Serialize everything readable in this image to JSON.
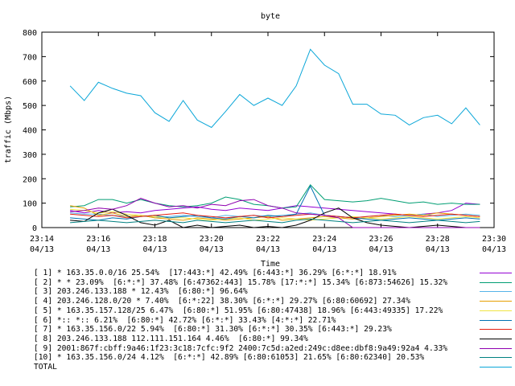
{
  "chart_data": {
    "type": "line",
    "title": "byte",
    "xlabel": "Time",
    "ylabel": "traffic (Mbps)",
    "ylim": [
      0,
      800
    ],
    "yticks": [
      0,
      100,
      200,
      300,
      400,
      500,
      600,
      700,
      800
    ],
    "xlim": [
      "23:14",
      "23:30"
    ],
    "xticks": [
      {
        "time": "23:14",
        "date": "04/13"
      },
      {
        "time": "23:16",
        "date": "04/13"
      },
      {
        "time": "23:18",
        "date": "04/13"
      },
      {
        "time": "23:20",
        "date": "04/13"
      },
      {
        "time": "23:22",
        "date": "04/13"
      },
      {
        "time": "23:24",
        "date": "04/13"
      },
      {
        "time": "23:26",
        "date": "04/13"
      },
      {
        "time": "23:28",
        "date": "04/13"
      },
      {
        "time": "23:30",
        "date": "04/13"
      }
    ],
    "grid": false,
    "legend_position": "bottom",
    "x": [
      "23:15",
      "23:15:30",
      "23:16",
      "23:16:30",
      "23:17",
      "23:17:30",
      "23:18",
      "23:18:30",
      "23:19",
      "23:19:30",
      "23:20",
      "23:20:30",
      "23:21",
      "23:21:30",
      "23:22",
      "23:22:30",
      "23:23",
      "23:23:30",
      "23:24",
      "23:24:30",
      "23:25",
      "23:25:30",
      "23:26",
      "23:26:30",
      "23:27",
      "23:27:30",
      "23:28",
      "23:28:30",
      "23:29",
      "23:29:30"
    ],
    "series": [
      {
        "name": "[ 1] * 163.35.0.0/16 25.54%  [17:443:*] 42.49% [6:443:*] 36.29% [6:*:*] 18.91%",
        "color": "#9400d3",
        "values": [
          70,
          60,
          70,
          60,
          65,
          60,
          70,
          75,
          80,
          85,
          75,
          70,
          80,
          75,
          70,
          80,
          90,
          85,
          80,
          75,
          70,
          65,
          60,
          55,
          50,
          55,
          60,
          70,
          100,
          95
        ]
      },
      {
        "name": "[ 2] * * 23.09%  [6:*:*] 37.48% [6:47362:443] 15.78% [17:*:*] 15.34% [6:873:54626] 15.32%",
        "color": "#009e73",
        "values": [
          85,
          90,
          115,
          115,
          100,
          115,
          100,
          90,
          85,
          90,
          100,
          125,
          115,
          95,
          90,
          80,
          85,
          175,
          115,
          110,
          105,
          110,
          120,
          110,
          100,
          105,
          95,
          100,
          95,
          95
        ]
      },
      {
        "name": "[ 3] 203.246.133.188 * 12.43%  [6:80:*] 96.64%",
        "color": "#56b4e9",
        "values": [
          60,
          55,
          55,
          50,
          45,
          50,
          40,
          45,
          50,
          45,
          40,
          50,
          45,
          50,
          45,
          50,
          55,
          60,
          50,
          45,
          40,
          45,
          50,
          45,
          50,
          55,
          45,
          50,
          55,
          50
        ]
      },
      {
        "name": "[ 4] 203.246.128.0/20 * 7.40%  [6:*:22] 38.30% [6:*:*] 29.27% [6:80:60692] 27.34%",
        "color": "#e69f00",
        "values": [
          90,
          80,
          50,
          60,
          45,
          50,
          40,
          35,
          30,
          40,
          35,
          30,
          35,
          40,
          45,
          30,
          35,
          40,
          45,
          40,
          35,
          40,
          45,
          50,
          55,
          50,
          60,
          55,
          50,
          45
        ]
      },
      {
        "name": "[ 5] * 163.35.157.128/25 6.47%  [6:80:*] 51.95% [6:80:47438] 18.96% [6:443:49335] 17.22%",
        "color": "#f0e442",
        "values": [
          75,
          70,
          60,
          65,
          55,
          50,
          45,
          40,
          40,
          35,
          30,
          35,
          40,
          30,
          35,
          40,
          35,
          30,
          35,
          40,
          45,
          40,
          35,
          40,
          45,
          40,
          35,
          40,
          45,
          40
        ]
      },
      {
        "name": "[ 6] *:: *:: 6.21%  [6:80:*] 42.72% [6:*:*] 33.43% [4:*:*] 22.71%",
        "color": "#0072b2",
        "values": [
          40,
          35,
          30,
          40,
          35,
          45,
          50,
          40,
          45,
          50,
          40,
          35,
          45,
          40,
          50,
          45,
          55,
          170,
          50,
          45,
          40,
          35,
          30,
          35,
          40,
          35,
          30,
          35,
          40,
          35
        ]
      },
      {
        "name": "[ 7] * 163.35.156.0/22 5.94%  [6:80:*] 31.30% [6:*:*] 30.35% [6:443:*] 29.23%",
        "color": "#e51e10",
        "values": [
          55,
          50,
          45,
          50,
          40,
          45,
          50,
          55,
          60,
          50,
          45,
          40,
          45,
          50,
          40,
          45,
          50,
          55,
          50,
          45,
          40,
          45,
          50,
          55,
          50,
          45,
          50,
          55,
          50,
          45
        ]
      },
      {
        "name": "[ 8] 203.246.133.188 112.111.151.164 4.46%  [6:80:*] 99.34%",
        "color": "#000000",
        "values": [
          30,
          25,
          60,
          75,
          50,
          20,
          10,
          30,
          0,
          10,
          0,
          5,
          10,
          0,
          5,
          0,
          10,
          30,
          60,
          80,
          40,
          20,
          10,
          5,
          0,
          5,
          10,
          5,
          0,
          0
        ]
      },
      {
        "name": "[ 9] 2001:867f:cbff:9a46:1f23:3c18:7cfc:9f2 2400:7c5d:a2ed:249c:d8ee:dbf8:9a49:92a4 4.33%",
        "color": "#9000b0",
        "values": [
          65,
          70,
          80,
          75,
          90,
          120,
          100,
          85,
          90,
          80,
          95,
          90,
          110,
          115,
          90,
          80,
          60,
          55,
          50,
          40,
          0,
          0,
          0,
          0,
          0,
          0,
          0,
          0,
          0,
          0
        ]
      },
      {
        "name": "[10] * 163.35.156.0/24 4.12%  [6:*:*] 42.89% [6:80:61053] 21.65% [6:80:62340] 20.53%",
        "color": "#008080",
        "values": [
          20,
          25,
          30,
          25,
          20,
          25,
          30,
          25,
          20,
          30,
          25,
          20,
          25,
          30,
          25,
          20,
          30,
          35,
          30,
          25,
          20,
          25,
          30,
          25,
          20,
          25,
          30,
          25,
          20,
          25
        ]
      },
      {
        "name": "TOTAL",
        "color": "#0aa6d8",
        "values": [
          580,
          520,
          595,
          570,
          550,
          540,
          470,
          435,
          520,
          440,
          410,
          475,
          545,
          500,
          530,
          500,
          580,
          730,
          665,
          630,
          505,
          505,
          465,
          460,
          420,
          450,
          460,
          425,
          490,
          420
        ]
      }
    ]
  }
}
